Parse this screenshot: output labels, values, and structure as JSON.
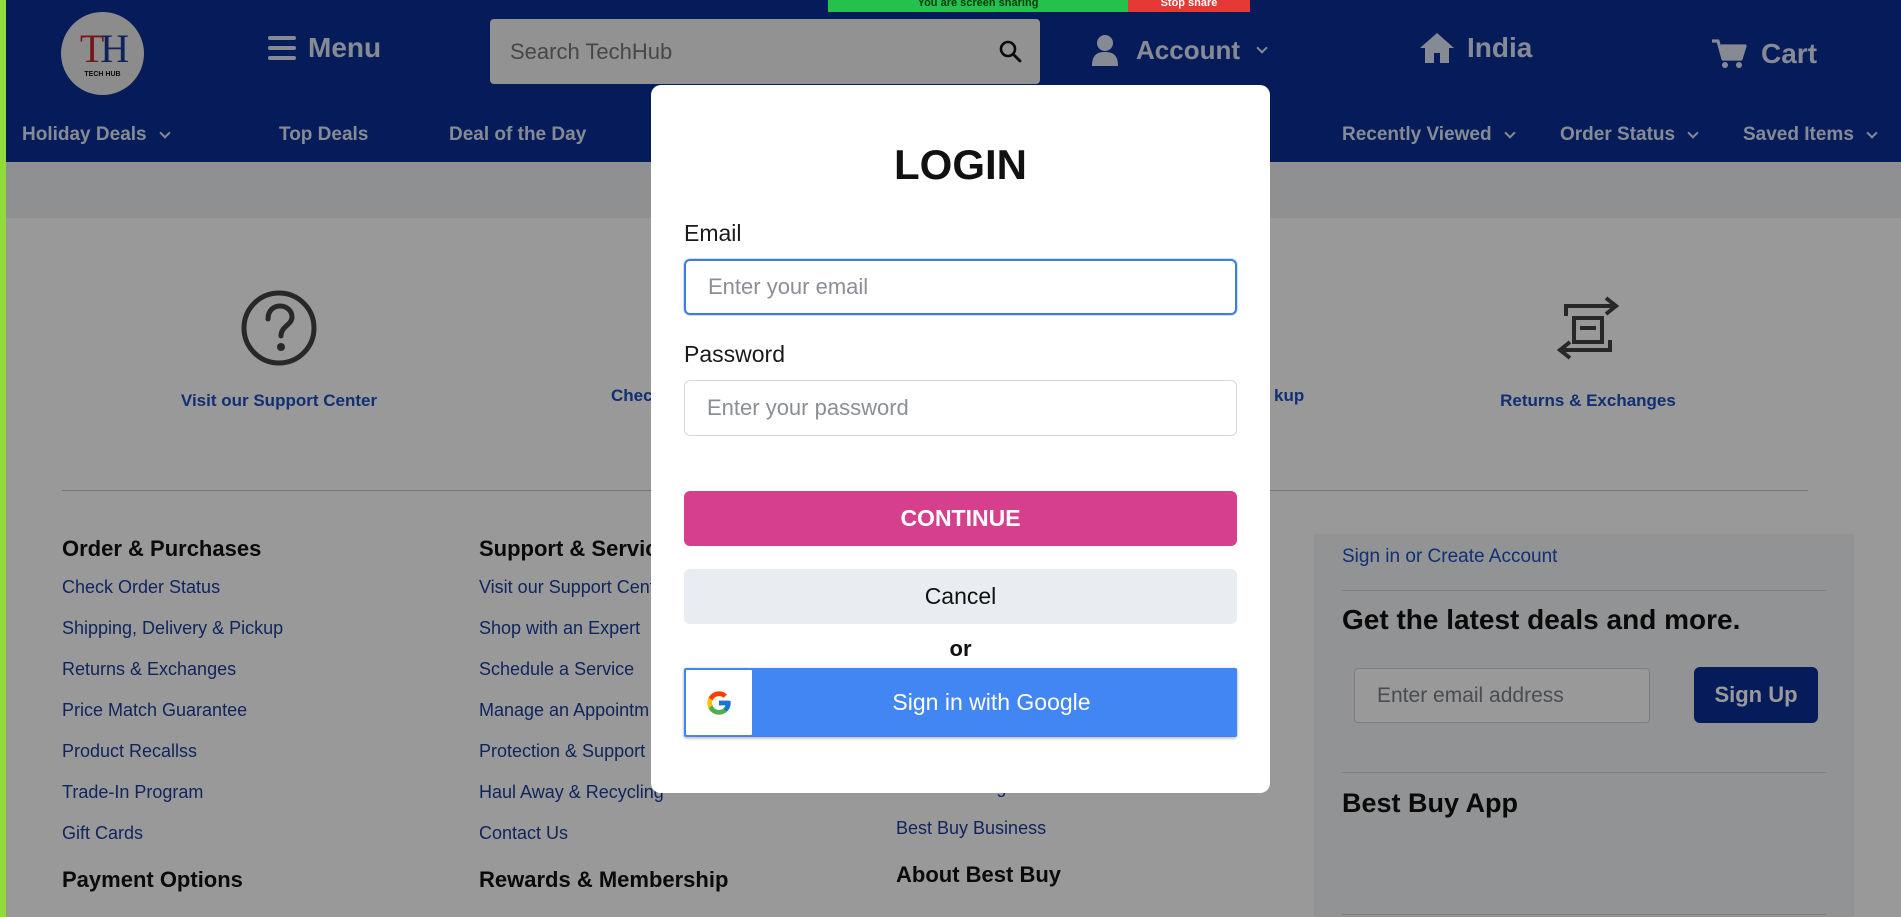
{
  "screen_share": {
    "message": "You are screen sharing",
    "stop_label": "Stop share"
  },
  "header": {
    "logo_letters": "TH",
    "logo_text": "TECH HUB",
    "menu_label": "Menu",
    "search_placeholder": "Search TechHub",
    "account_label": "Account",
    "location_label": "India",
    "cart_label": "Cart"
  },
  "subnav": {
    "items": [
      {
        "label": "Holiday Deals"
      },
      {
        "label": "Top Deals"
      },
      {
        "label": "Deal of the Day"
      },
      {
        "label": "Recently Viewed"
      },
      {
        "label": "Order Status"
      },
      {
        "label": "Saved Items"
      }
    ]
  },
  "services": [
    {
      "label": "Visit our Support Center",
      "icon": "question-circle-icon"
    },
    {
      "label": "Chec",
      "icon": "hidden"
    },
    {
      "label": "kup",
      "icon": "hidden"
    },
    {
      "label": "Returns & Exchanges",
      "icon": "returns-exchange-icon"
    }
  ],
  "footer": {
    "col1": {
      "title": "Order & Purchases",
      "links": [
        "Check Order Status",
        "Shipping, Delivery & Pickup",
        "Returns & Exchanges",
        "Price Match Guarantee",
        "Product Recallss",
        "Trade-In Program",
        "Gift Cards"
      ],
      "next_title": "Payment Options"
    },
    "col2": {
      "title": "Support & Servic",
      "links": [
        "Visit our Support Cent",
        "Shop with an Expert",
        "Schedule a Service",
        "Manage an Appointm",
        "Protection & Support",
        "Haul Away & Recycling",
        "Contact Us"
      ],
      "next_title": "Rewards & Membership"
    },
    "col3": {
      "links": [
        "Trade-In Program",
        "Best Buy Business"
      ],
      "next_title": "About Best Buy"
    },
    "newsletter": {
      "signin_link": "Sign in or Create Account",
      "heading": "Get the latest deals and more.",
      "email_placeholder": "Enter email address",
      "signup_label": "Sign Up",
      "app_heading": "Best Buy App"
    }
  },
  "login_modal": {
    "title": "LOGIN",
    "email_label": "Email",
    "email_placeholder": "Enter your email",
    "password_label": "Password",
    "password_placeholder": "Enter your password",
    "continue_label": "CONTINUE",
    "cancel_label": "Cancel",
    "or_label": "or",
    "google_label": "Sign in with Google"
  },
  "colors": {
    "header_bg": "#0a2f96",
    "continue_bg": "#d63f8c",
    "google_bg": "#4286f4",
    "link": "#1d4fbf"
  }
}
